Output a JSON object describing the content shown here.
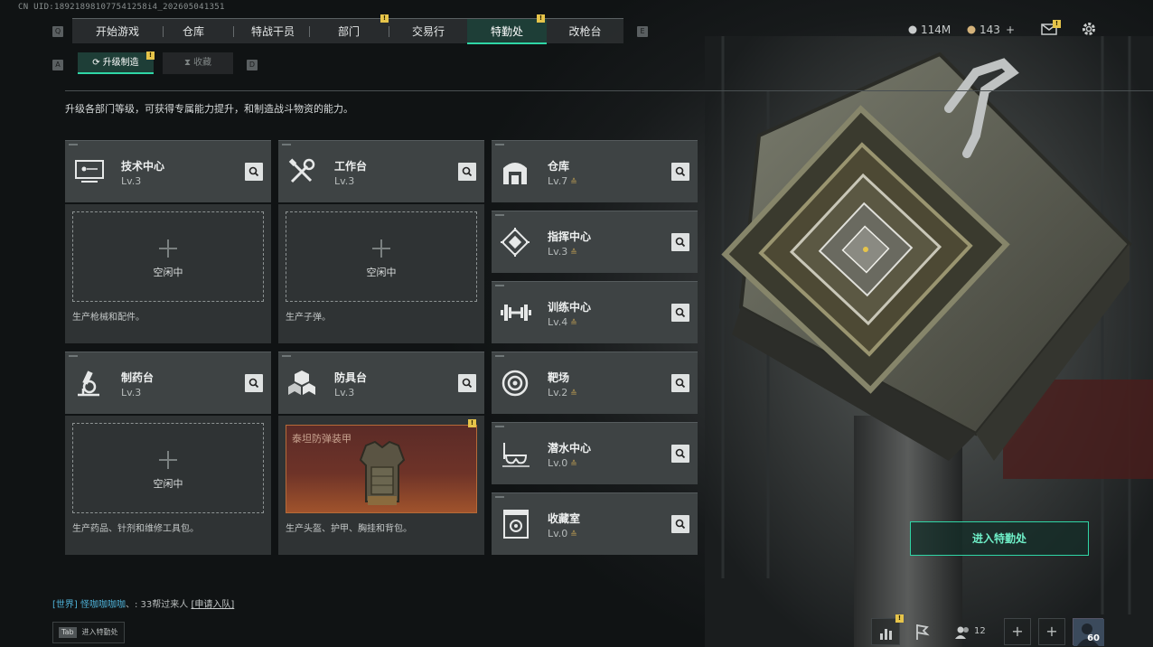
{
  "uid": "CN UID:189218981077541258i4_202605041351",
  "nav": {
    "key_left": "Q",
    "key_right": "E",
    "tabs": [
      {
        "label": "开始游戏"
      },
      {
        "label": "仓库"
      },
      {
        "label": "特战干员"
      },
      {
        "label": "部门",
        "badge": "!"
      },
      {
        "label": "交易行"
      },
      {
        "label": "特勤处",
        "badge": "!",
        "active": true
      },
      {
        "label": "改枪台"
      }
    ]
  },
  "subnav": {
    "key_left": "A",
    "key_right": "D",
    "tabs": [
      {
        "label": "升级制造",
        "badge": "!",
        "active": true
      },
      {
        "label": "收藏"
      }
    ]
  },
  "currency": {
    "coins": "114M",
    "tokens": "143",
    "add": "+"
  },
  "mail_badge": "!",
  "intro": "升级各部门等级，可获得专属能力提升，和制造战斗物资的能力。",
  "left_cards": [
    {
      "name": "技术中心",
      "level": "Lv.3",
      "icon": "computer-icon",
      "slot_status": "空闲中",
      "slot_desc": "生产枪械和配件。"
    },
    {
      "name": "工作台",
      "level": "Lv.3",
      "icon": "tools-icon",
      "slot_status": "空闲中",
      "slot_desc": "生产子弹。"
    },
    {
      "name": "制药台",
      "level": "Lv.3",
      "icon": "microscope-icon",
      "slot_status": "空闲中",
      "slot_desc": "生产药品、针剂和维修工具包。"
    },
    {
      "name": "防具台",
      "level": "Lv.3",
      "icon": "cubes-icon",
      "slot_status": "",
      "slot_item": "泰坦防弹装甲",
      "slot_badge": "!",
      "slot_desc": "生产头盔、护甲、胸挂和背包。"
    }
  ],
  "right_cards": [
    {
      "name": "仓库",
      "level": "Lv.7",
      "icon": "warehouse-icon"
    },
    {
      "name": "指挥中心",
      "level": "Lv.3",
      "icon": "command-icon"
    },
    {
      "name": "训练中心",
      "level": "Lv.4",
      "icon": "dumbbell-icon"
    },
    {
      "name": "靶场",
      "level": "Lv.2",
      "icon": "target-icon"
    },
    {
      "name": "潜水中心",
      "level": "Lv.0",
      "icon": "diving-mask-icon"
    },
    {
      "name": "收藏室",
      "level": "Lv.0",
      "icon": "collection-icon"
    }
  ],
  "upgrade_arrow": "≙",
  "enter_button": "进入特勤处",
  "chat": {
    "channel": "[世界]",
    "name": "怪咖咖咖咖",
    "message": "、: 33帮过来人",
    "link": "[申请入队]"
  },
  "tab_hint": {
    "key": "Tab",
    "label": "进入特勤处"
  },
  "bottom": {
    "friends_count": "12",
    "plus": "+",
    "avatar_level": "60",
    "stats_badge": "!"
  },
  "colors": {
    "accent": "#2fd6a6",
    "badge": "#e6c44a",
    "card": "#3e4344"
  }
}
